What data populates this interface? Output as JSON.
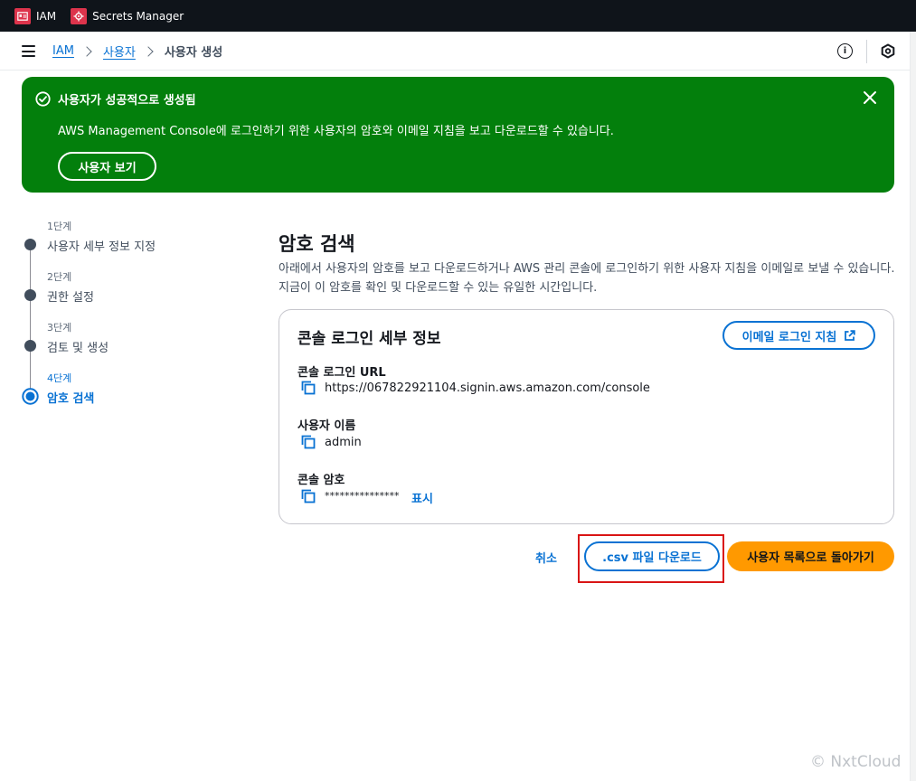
{
  "service_bar": {
    "items": [
      {
        "label": "IAM",
        "icon": "iam-icon"
      },
      {
        "label": "Secrets Manager",
        "icon": "secrets-manager-icon"
      }
    ],
    "icon_color": "#dd344c"
  },
  "breadcrumb": {
    "items": [
      {
        "label": "IAM",
        "link": true
      },
      {
        "label": "사용자",
        "link": true
      },
      {
        "label": "사용자 생성",
        "link": false
      }
    ],
    "info_icon_glyph": "i"
  },
  "flash": {
    "title": "사용자가 성공적으로 생성됨",
    "message": "AWS Management Console에 로그인하기 위한 사용자의 암호와 이메일 지침을 보고 다운로드할 수 있습니다.",
    "button_label": "사용자 보기",
    "color": "#037f0c"
  },
  "steps": [
    {
      "step": "1단계",
      "label": "사용자 세부 정보 지정"
    },
    {
      "step": "2단계",
      "label": "권한 설정"
    },
    {
      "step": "3단계",
      "label": "검토 및 생성"
    },
    {
      "step": "4단계",
      "label": "암호 검색",
      "active": true
    }
  ],
  "main": {
    "title": "암호 검색",
    "description": "아래에서 사용자의 암호를 보고 다운로드하거나 AWS 관리 콘솔에 로그인하기 위한 사용자 지침을 이메일로 보낼 수 있습니다. 지금이 이 암호를 확인 및 다운로드할 수 있는 유일한 시간입니다."
  },
  "card": {
    "title": "콘솔 로그인 세부 정보",
    "email_button_label": "이메일 로그인 지침",
    "fields": [
      {
        "label": "콘솔 로그인 URL",
        "value": "https://067822921104.signin.aws.amazon.com/console"
      },
      {
        "label": "사용자 이름",
        "value": "admin"
      },
      {
        "label": "콘솔 암호",
        "value": "***************",
        "show_label": "표시"
      }
    ]
  },
  "actions": {
    "cancel_label": "취소",
    "csv_label": ".csv 파일 다운로드",
    "back_label": "사용자 목록으로 돌아가기",
    "primary_color": "#ff9900",
    "highlight_color": "#d91515"
  },
  "watermark": "© NxtCloud"
}
